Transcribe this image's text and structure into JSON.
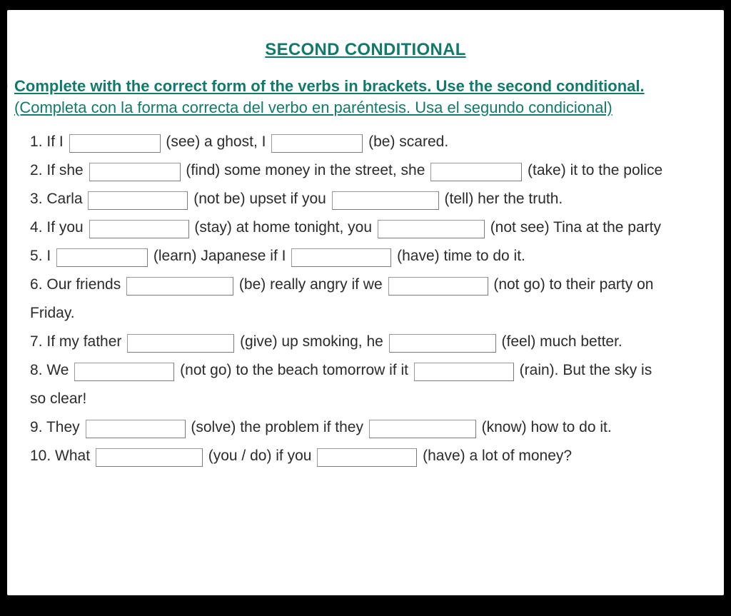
{
  "title": "SECOND CONDITIONAL",
  "instructions": {
    "bold": "Complete with the correct form of the verbs in brackets. Use the second conditional.",
    "paren": " (Completa con la forma correcta del verbo en paréntesis. Usa el segundo condicional)"
  },
  "q": {
    "1": {
      "a": "If I ",
      "b": " (see) a ghost, I ",
      "c": " (be) scared."
    },
    "2": {
      "a": "If she ",
      "b": " (find) some money in the street, she ",
      "c": " (take) it to the police"
    },
    "3": {
      "a": "Carla ",
      "b": " (not be) upset if you ",
      "c": " (tell) her the truth."
    },
    "4": {
      "a": "If you ",
      "b": " (stay) at home tonight, you ",
      "c": " (not see) Tina at the party"
    },
    "5": {
      "a": "I ",
      "b": " (learn) Japanese if I ",
      "c": " (have) time to do it."
    },
    "6": {
      "a": "Our friends ",
      "b": " (be) really angry if we ",
      "c": " (not go) to their party on",
      "d": "Friday."
    },
    "7": {
      "a": "If my father ",
      "b": " (give) up smoking, he ",
      "c": " (feel) much better."
    },
    "8": {
      "a": "We ",
      "b": " (not go) to the beach tomorrow if it ",
      "c": " (rain). But the sky is",
      "d": "so clear!"
    },
    "9": {
      "a": "They ",
      "b": " (solve) the problem if they ",
      "c": " (know) how to do it."
    },
    "10": {
      "a": "What ",
      "b": " (you / do) if you ",
      "c": " (have) a lot of money?"
    }
  }
}
